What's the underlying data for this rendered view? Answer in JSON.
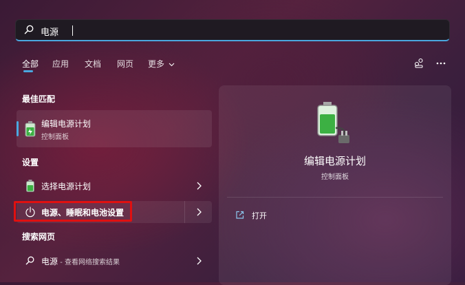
{
  "search": {
    "query": "电源"
  },
  "tabs": [
    {
      "label": "全部",
      "active": true
    },
    {
      "label": "应用"
    },
    {
      "label": "文档"
    },
    {
      "label": "网页"
    },
    {
      "label": "更多"
    }
  ],
  "headers": {
    "best_match": "最佳匹配",
    "settings": "设置",
    "web": "搜索网页"
  },
  "best_match": {
    "title": "编辑电源计划",
    "subtitle": "控制面板",
    "icon": "battery-plug-icon"
  },
  "settings_items": [
    {
      "label": "选择电源计划",
      "icon": "battery-icon"
    },
    {
      "label": "电源、睡眠和电池设置",
      "icon": "power-icon"
    }
  ],
  "web_item": {
    "query": "电源",
    "suffix": " - 查看网络搜索结果"
  },
  "preview": {
    "title": "编辑电源计划",
    "subtitle": "控制面板",
    "actions": [
      {
        "label": "打开",
        "icon": "open-external-icon"
      }
    ]
  },
  "colors": {
    "accent": "#4aa8e0",
    "highlight_frame": "#e01010",
    "battery_green": "#3cb043"
  }
}
